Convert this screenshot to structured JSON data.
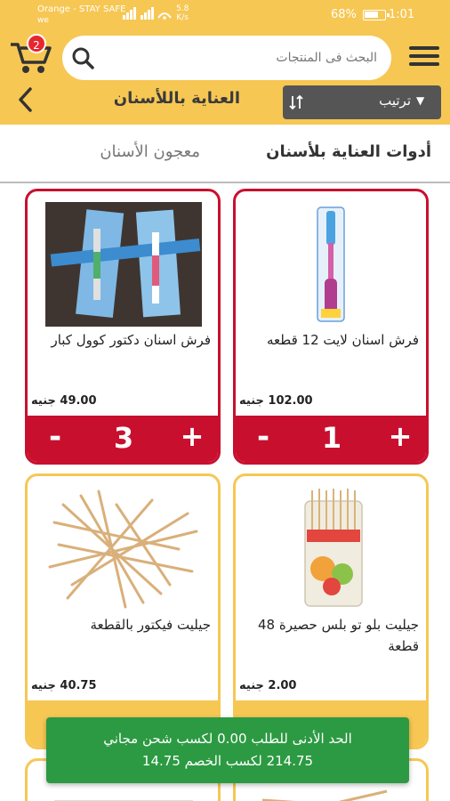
{
  "status_bar": {
    "carrier": "Orange - STAY SAFE",
    "carrier_sub": "we",
    "speed": "5.8\nK/s",
    "battery_pct": "68%",
    "time": "1:01"
  },
  "header": {
    "cart_count": "2",
    "search_placeholder": "البحث فى المنتجات",
    "sort_label": "ترتيب",
    "page_title": "العناية باللأسنان"
  },
  "tabs": [
    {
      "label": "أدوات العناية بلأسنان",
      "active": true
    },
    {
      "label": "معجون الأسنان",
      "active": false
    }
  ],
  "products": [
    {
      "name": "فرش اسنان لايت 12 قطعه",
      "price": "102.00 جنيه",
      "qty": "1",
      "minus": "-",
      "plus": "+",
      "border": "#c8102e"
    },
    {
      "name": "فرش اسنان دكتور كوول كبار",
      "price": "49.00 جنيه",
      "qty": "3",
      "minus": "-",
      "plus": "+",
      "border": "#c8102e"
    },
    {
      "name": "جيليت بلو تو بلس حصيرة 48 قطعة",
      "price": "2.00 جنيه",
      "border": "#f7c754"
    },
    {
      "name": "جيليت فيكتور بالقطعة",
      "price": "40.75 جنيه",
      "border": "#f7c754"
    }
  ],
  "toast": {
    "line1": "الحد الأدنى للطلب 0.00 لكسب شحن مجاني",
    "line2": "214.75 لكسب الخصم 14.75"
  },
  "colors": {
    "header": "#f7c754",
    "accent_red": "#c8102e",
    "toast_green": "#2c9a42"
  }
}
